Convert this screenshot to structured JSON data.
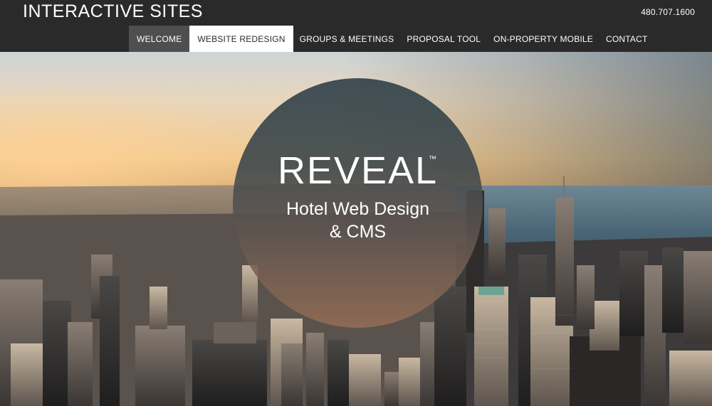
{
  "header": {
    "logo_text": "INTERACTIVE SITES",
    "phone": "480.707.1600",
    "nav": [
      {
        "label": "WELCOME"
      },
      {
        "label": "WEBSITE REDESIGN"
      },
      {
        "label": "GROUPS & MEETINGS"
      },
      {
        "label": "PROPOSAL TOOL"
      },
      {
        "label": "ON-PROPERTY MOBILE"
      },
      {
        "label": "CONTACT"
      }
    ]
  },
  "hero": {
    "title": "REVEAL",
    "trademark": "™",
    "subtitle_line1": "Hotel Web Design",
    "subtitle_line2": "& CMS"
  },
  "colors": {
    "header_bg": "#2a2a2a",
    "nav_active_dark": "#4f4f4f",
    "nav_active_light": "#ffffff"
  }
}
